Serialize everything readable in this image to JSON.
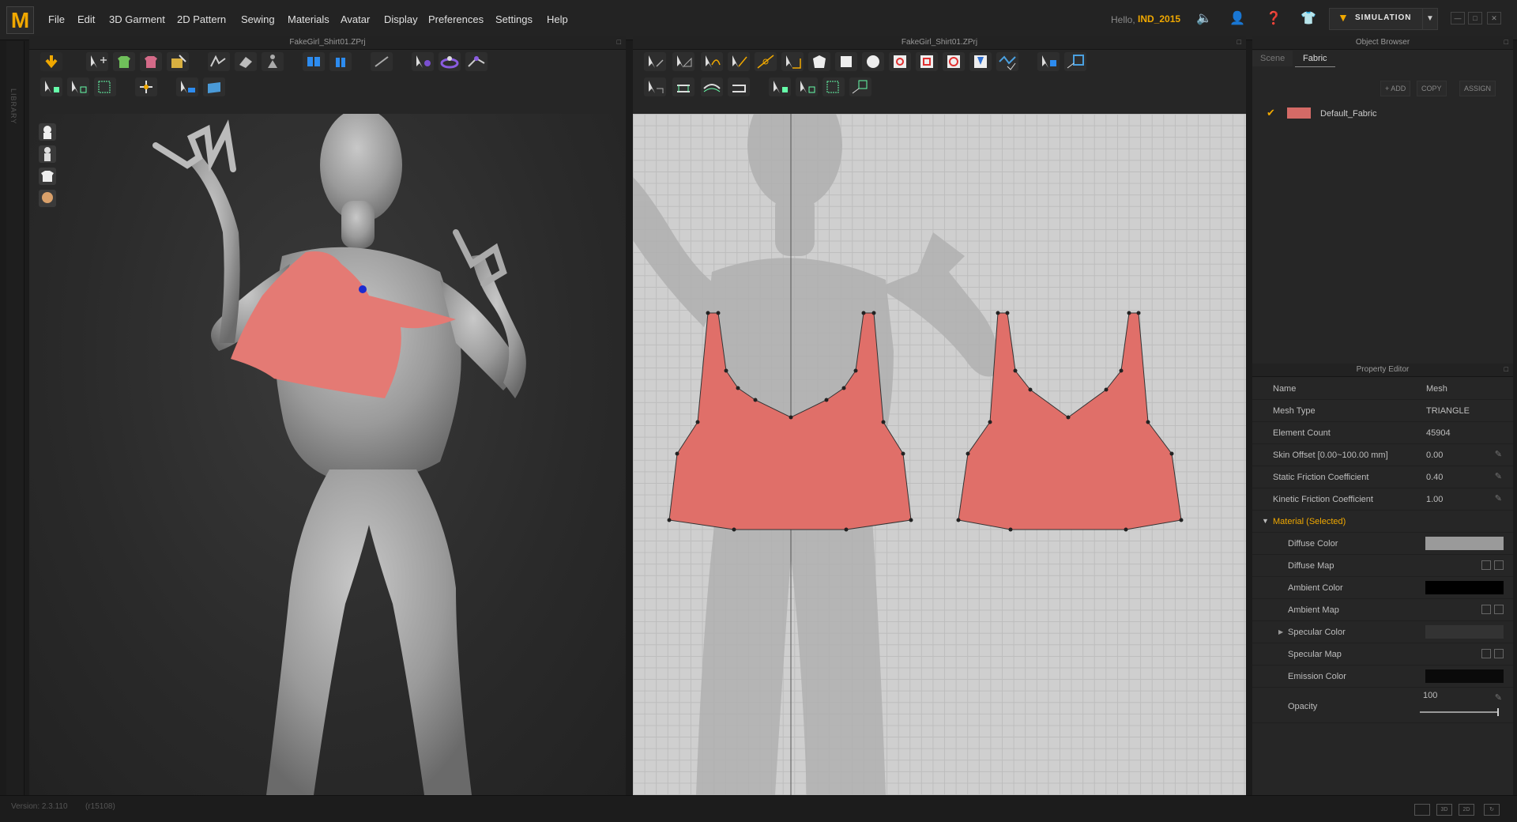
{
  "app": {
    "logo_letter": "M"
  },
  "menu": [
    "File",
    "Edit",
    "3D Garment",
    "2D Pattern",
    "Sewing",
    "Materials",
    "Avatar",
    "Display",
    "Preferences",
    "Settings",
    "Help"
  ],
  "user": {
    "greeting": "Hello,",
    "name": "IND_2015"
  },
  "simulation": {
    "label": "SIMULATION"
  },
  "library": {
    "label": "LIBRARY"
  },
  "window_3d": {
    "title": "FakeGirl_Shirt01.ZPrj"
  },
  "window_2d": {
    "title": "FakeGirl_Shirt01.ZPrj"
  },
  "object_browser": {
    "title": "Object Browser",
    "tabs": [
      "Scene",
      "Fabric"
    ],
    "active_tab": "Fabric",
    "buttons": {
      "add": "+ ADD",
      "copy": "COPY",
      "assign": "ASSIGN"
    },
    "fabrics": [
      {
        "name": "Default_Fabric",
        "color": "#d46a66",
        "checked": true
      }
    ]
  },
  "property_editor": {
    "title": "Property Editor",
    "rows": [
      {
        "label": "Name",
        "value": "Mesh"
      },
      {
        "label": "Mesh Type",
        "value": "TRIANGLE"
      },
      {
        "label": "Element Count",
        "value": "45904"
      },
      {
        "label": "Skin Offset [0.00~100.00 mm]",
        "value": "0.00"
      },
      {
        "label": "Static Friction Coefficient",
        "value": "0.40"
      },
      {
        "label": "Kinetic Friction Coefficient",
        "value": "1.00"
      }
    ],
    "material_section": "Material (Selected)",
    "material_rows": [
      {
        "label": "Diffuse Color",
        "swatch": "#9a9a9a"
      },
      {
        "label": "Diffuse Map"
      },
      {
        "label": "Ambient Color",
        "swatch": "#000000"
      },
      {
        "label": "Ambient Map"
      },
      {
        "label": "Specular Color",
        "swatch": "#333333"
      },
      {
        "label": "Specular Map"
      },
      {
        "label": "Emission Color",
        "swatch": "#0a0a0a"
      }
    ],
    "opacity": {
      "label": "Opacity",
      "value": "100",
      "level": 1.0
    }
  },
  "status": {
    "version": "Version: 2.3.110",
    "build": "(r15108)"
  },
  "colors": {
    "accent": "#f0a800",
    "garment": "#e06f69",
    "grid_bg": "#cfcfcf"
  }
}
